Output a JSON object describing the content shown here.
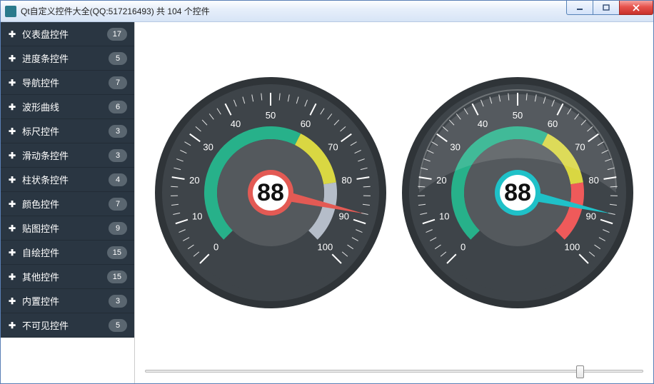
{
  "window": {
    "title": "Qt自定义控件大全(QQ:517216493) 共 104 个控件"
  },
  "sidebar": {
    "items": [
      {
        "label": "仪表盘控件",
        "count": 17
      },
      {
        "label": "进度条控件",
        "count": 5
      },
      {
        "label": "导航控件",
        "count": 7
      },
      {
        "label": "波形曲线",
        "count": 6
      },
      {
        "label": "标尺控件",
        "count": 3
      },
      {
        "label": "滑动条控件",
        "count": 3
      },
      {
        "label": "柱状条控件",
        "count": 4
      },
      {
        "label": "颜色控件",
        "count": 7
      },
      {
        "label": "贴图控件",
        "count": 9
      },
      {
        "label": "自绘控件",
        "count": 15
      },
      {
        "label": "其他控件",
        "count": 15
      },
      {
        "label": "内置控件",
        "count": 3
      },
      {
        "label": "不可见控件",
        "count": 5
      }
    ]
  },
  "chart_data": [
    {
      "type": "gauge",
      "min": 0,
      "max": 100,
      "value": 88,
      "major_step": 10,
      "tick_labels": [
        0,
        10,
        20,
        30,
        40,
        50,
        60,
        70,
        80,
        90,
        100
      ],
      "color_bands": [
        {
          "from": 0,
          "to": 60,
          "color": "#27b18a"
        },
        {
          "from": 60,
          "to": 80,
          "color": "#d9d742"
        },
        {
          "from": 80,
          "to": 100,
          "color": "#b5bdc9"
        }
      ],
      "needle_color": "#e35a54",
      "hub_ring_color": "#e35a54",
      "glass_overlay": false
    },
    {
      "type": "gauge",
      "min": 0,
      "max": 100,
      "value": 88,
      "major_step": 10,
      "tick_labels": [
        0,
        10,
        20,
        30,
        40,
        50,
        60,
        70,
        80,
        90,
        100
      ],
      "color_bands": [
        {
          "from": 0,
          "to": 60,
          "color": "#27b18a"
        },
        {
          "from": 60,
          "to": 80,
          "color": "#d9d742"
        },
        {
          "from": 80,
          "to": 100,
          "color": "#ef5a5a"
        }
      ],
      "needle_color": "#1fc1c8",
      "hub_ring_color": "#1fc1c8",
      "glass_overlay": true
    }
  ],
  "slider": {
    "min": 0,
    "max": 100,
    "value": 88
  }
}
